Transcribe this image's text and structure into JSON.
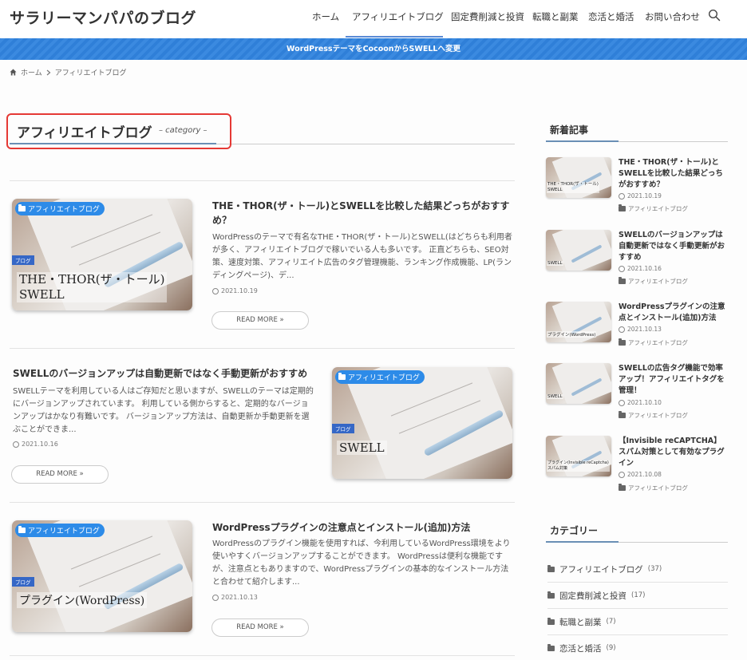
{
  "site": {
    "title": "サラリーマンパパのブログ"
  },
  "nav": [
    {
      "label": "ホーム"
    },
    {
      "label": "アフィリエイトブログ"
    },
    {
      "label": "固定費削減と投資"
    },
    {
      "label": "転職と副業"
    },
    {
      "label": "恋活と婚活"
    },
    {
      "label": "お問い合わせ"
    }
  ],
  "notice": "WordPressテーマをCocoonからSWELLへ変更",
  "breadcrumb": {
    "home": "ホーム",
    "current": "アフィリエイトブログ"
  },
  "page": {
    "title": "アフィリエイトブログ",
    "subtitle": "– category –"
  },
  "posts": [
    {
      "category": "アフィリエイトブログ",
      "thumb_tag": "ブログ",
      "thumb_text": "THE・THOR(ザ・トール)\nSWELL",
      "title": "THE・THOR(ザ・トール)とSWELLを比較した結果どっちがおすすめ？",
      "excerpt": "WordPressのテーマで有名なTHE・THOR(ザ・トール)とSWELL(はどちらも利用者が多く、アフィリエイトブログで稼いでいる人も多いです。 正直どちらも、SEO対策、速度対策、アフィリエイト広告のタグ管理機能、ランキング作成機能、LP(ランディングページ)、デ...",
      "date": "2021.10.19",
      "read_more": "READ MORE »"
    },
    {
      "category": "アフィリエイトブログ",
      "thumb_tag": "ブログ",
      "thumb_text": "SWELL",
      "title": "SWELLのバージョンアップは自動更新ではなく手動更新がおすすめ",
      "excerpt": "SWELLテーマを利用している人はご存知だと思いますが、SWELLのテーマは定期的にバージョンアップされています。 利用している側からすると、定期的なバージョンアップはかなり有難いです。 バージョンアップ方法は、自動更新か手動更新を選ぶことができま...",
      "date": "2021.10.16",
      "read_more": "READ MORE »"
    },
    {
      "category": "アフィリエイトブログ",
      "thumb_tag": "ブログ",
      "thumb_text": "プラグイン(WordPress)",
      "title": "WordPressプラグインの注意点とインストール(追加)方法",
      "excerpt": "WordPressのプラグイン機能を使用すれば、今利用しているWordPress環境をより使いやすくバージョンアップすることができます。 WordPressは便利な機能ですが、注意点ともありますので、WordPressプラグインの基本的なインストール方法と合わせて紹介します...",
      "date": "2021.10.13",
      "read_more": "READ MORE »"
    }
  ],
  "sidebar": {
    "recent_heading": "新着記事",
    "recent": [
      {
        "title": "THE・THOR(ザ・トール)とSWELLを比較した結果どっちがおすすめ？",
        "date": "2021.10.19",
        "category": "アフィリエイトブログ",
        "thumb_text": "THE・THOR(ザ・トール)\nSWELL"
      },
      {
        "title": "SWELLのバージョンアップは自動更新ではなく手動更新がおすすめ",
        "date": "2021.10.16",
        "category": "アフィリエイトブログ",
        "thumb_text": "SWELL"
      },
      {
        "title": "WordPressプラグインの注意点とインストール(追加)方法",
        "date": "2021.10.13",
        "category": "アフィリエイトブログ",
        "thumb_text": "プラグイン(WordPress)"
      },
      {
        "title": "SWELLの広告タグ機能で効率アップ！アフィリエイトタグを管理！",
        "date": "2021.10.10",
        "category": "アフィリエイトブログ",
        "thumb_text": "SWELL"
      },
      {
        "title": "【Invisible reCAPTCHA】スパム対策として有効なプラグイン",
        "date": "2021.10.08",
        "category": "アフィリエイトブログ",
        "thumb_text": "プラグイン(Invisible reCaptcha)\nスパム対策"
      }
    ],
    "category_heading": "カテゴリー",
    "categories": [
      {
        "name": "アフィリエイトブログ",
        "count": "(37)"
      },
      {
        "name": "固定費削減と投資",
        "count": "(17)"
      },
      {
        "name": "転職と副業",
        "count": "(7)"
      },
      {
        "name": "恋活と婚活",
        "count": "(9)"
      }
    ]
  },
  "colors": {
    "accent": "#2d8be8",
    "notice_bg": "#2f7fd8",
    "highlight_border": "#e53935"
  }
}
